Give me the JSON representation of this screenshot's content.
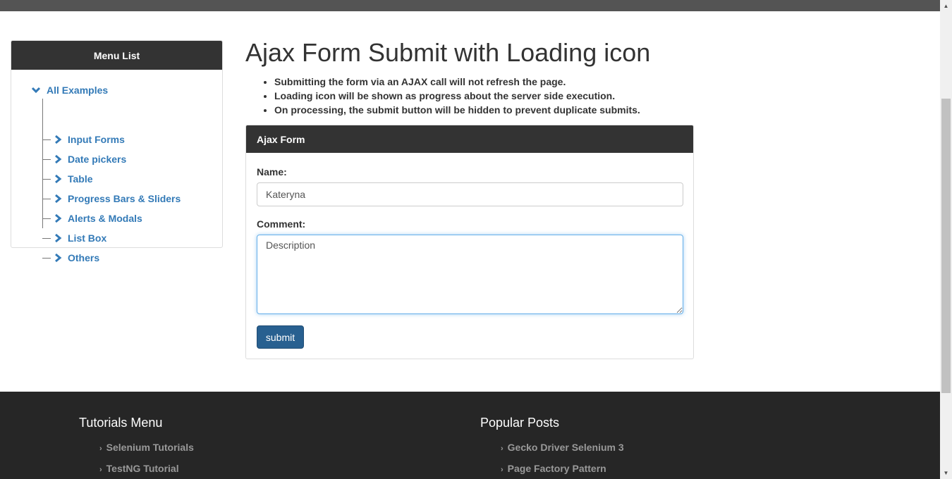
{
  "sidebar": {
    "header": "Menu List",
    "root_label": "All Examples",
    "items": [
      {
        "label": "Input Forms"
      },
      {
        "label": "Date pickers"
      },
      {
        "label": "Table"
      },
      {
        "label": "Progress Bars & Sliders"
      },
      {
        "label": "Alerts & Modals"
      },
      {
        "label": "List Box"
      },
      {
        "label": "Others"
      }
    ]
  },
  "main": {
    "title": "Ajax Form Submit with Loading icon",
    "bullets": [
      "Submitting the form via an AJAX call will not refresh the page.",
      "Loading icon will be shown as progress about the server side execution.",
      "On processing, the submit button will be hidden to prevent duplicate submits."
    ]
  },
  "form": {
    "header": "Ajax Form",
    "name_label": "Name:",
    "name_value": "Kateryna",
    "comment_label": "Comment:",
    "comment_placeholder": "Description",
    "submit_label": "submit"
  },
  "footer": {
    "tutorials": {
      "title": "Tutorials Menu",
      "links": [
        "Selenium Tutorials",
        "TestNG Tutorial"
      ]
    },
    "popular": {
      "title": "Popular Posts",
      "links": [
        "Gecko Driver Selenium 3",
        "Page Factory Pattern"
      ]
    }
  },
  "colors": {
    "accent": "#337ab7",
    "button": "#286090",
    "header_dark": "#333333",
    "footer_bg": "#262626"
  },
  "icons": {
    "tree_expand": "chevron-down-icon",
    "tree_item": "chevron-right-icon",
    "footer_link": "angle-right-icon"
  }
}
